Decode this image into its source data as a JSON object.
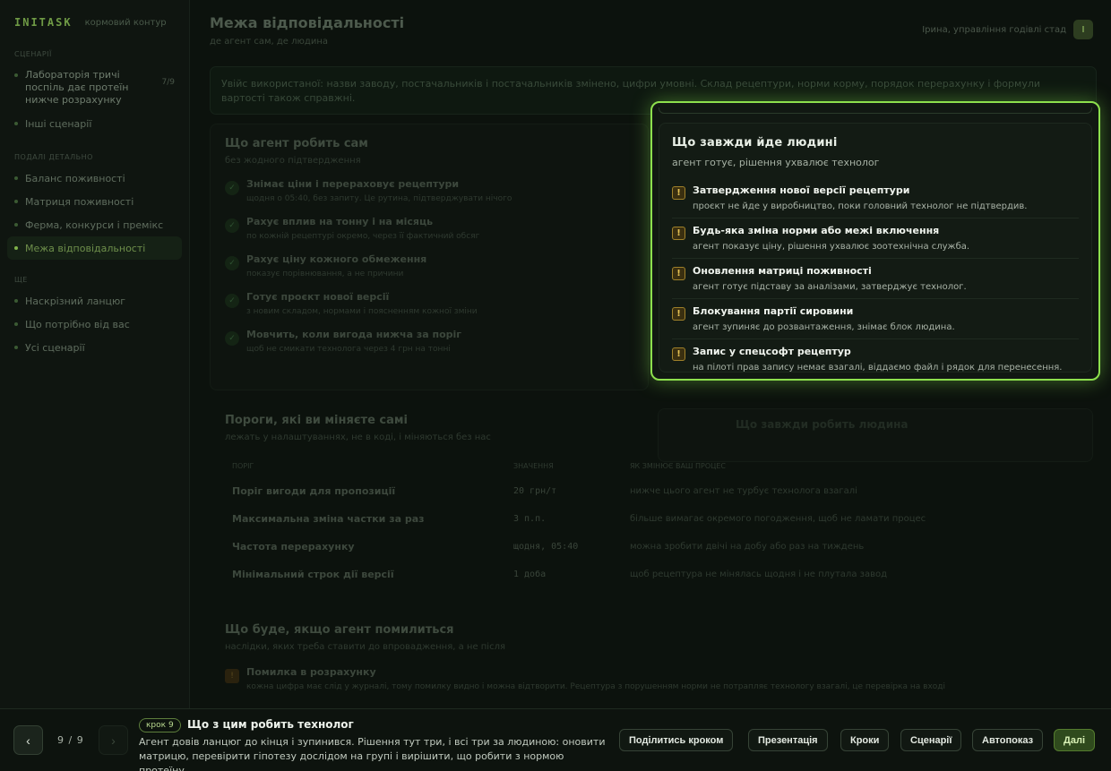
{
  "brand": {
    "logo": "INITASK",
    "subtitle": "кормовий контур"
  },
  "sidebar": {
    "scenarios_heading": "СЦЕНАРІЇ",
    "scenario": {
      "label": "Лабораторія тричі поспіль дає протеїн нижче розрахунку",
      "count": "7/9"
    },
    "other_scenarios": "Інші сценарії",
    "detail_heading": "ПОДАЛІ ДЕТАЛЬНО",
    "detail_items": [
      "Баланс поживності",
      "Матриця поживності",
      "Ферма, конкурси і премікс",
      "Межа відповідальності"
    ],
    "more_heading": "ЩЕ",
    "more_items": [
      "Наскрізний ланцюг",
      "Що потрібно від вас",
      "Усі сценарії"
    ]
  },
  "header": {
    "title": "Межа відповідальності",
    "subtitle": "де агент сам, де людина",
    "user": "Ірина, управління годівлі стад",
    "avatar": "І"
  },
  "callout": "Увійс використаної: назви заводу, постачальників і постачальників змінено, цифри умовні. Склад рецептури, норми корму, порядок перерахунку і формули вартості також справжні.",
  "agent_card": {
    "title": "Що агент робить сам",
    "subtitle": "без жодного підтвердження",
    "steps": [
      {
        "title": "Знімає ціни і перераховує рецептури",
        "desc": "щодня о 05:40, без запиту. Це рутина, підтверджувати нічого"
      },
      {
        "title": "Рахує вплив на тонну і на місяць",
        "desc": "по кожній рецептурі окремо, через її фактичний обсяг"
      },
      {
        "title": "Рахує ціну кожного обмеження",
        "desc": "показує порівнювання, а не причини"
      },
      {
        "title": "Готує проєкт нової версії",
        "desc": "з новим складом, нормами і поясненням кожної зміни"
      },
      {
        "title": "Мовчить, коли вигода нижча за поріг",
        "desc": "щоб не смикати технолога через 4 грн на тонні"
      }
    ]
  },
  "thresholds": {
    "title": "Пороги, які ви міняєте самі",
    "subtitle": "лежать у налаштуваннях, не в коді, і міняються без нас",
    "headers": [
      "ПОРІГ",
      "ЗНАЧЕННЯ",
      "ЯК ЗМІНЮЄ ВАШ ПРОЦЕС"
    ],
    "rows": [
      {
        "name": "Поріг вигоди для пропозиції",
        "value": "20 грн/т",
        "effect": "нижче цього агент не турбує технолога взагалі"
      },
      {
        "name": "Максимальна зміна частки за раз",
        "value": "3 п.п.",
        "effect": "більше вимагає окремого погодження, щоб не ламати процес"
      },
      {
        "name": "Частота перерахунку",
        "value": "щодня, 05:40",
        "effect": "можна зробити двічі на добу або раз на тиждень"
      },
      {
        "name": "Мінімальний строк дії версії",
        "value": "1 доба",
        "effect": "щоб рецептура не мінялась щодня і не плутала завод"
      }
    ]
  },
  "ghost_card_title": "Що завжди робить людина",
  "errors": {
    "title": "Що буде, якщо агент помилиться",
    "subtitle": "наслідки, яких треба ставити до впровадження, а не після",
    "item": {
      "title": "Помилка в розрахунку",
      "desc": "кожна цифра має слід у журналі, тому помилку видно і можна відтворити. Рецептура з порушенням норми не потрапляє технологу взагалі, це перевірка на вході"
    }
  },
  "modal": {
    "title": "Що завжди йде людині",
    "subtitle": "агент готує, рішення ухвалює технолог",
    "items": [
      {
        "title": "Затвердження нової версії рецептури",
        "desc": "проєкт не йде у виробництво, поки головний технолог не підтвердив."
      },
      {
        "title": "Будь-яка зміна норми або межі включення",
        "desc": "агент показує ціну, рішення ухвалює зоотехнічна служба."
      },
      {
        "title": "Оновлення матриці поживності",
        "desc": "агент готує підставу за аналізами, затверджує технолог."
      },
      {
        "title": "Блокування партії сировини",
        "desc": "агент зупиняє до розвантаження, знімає блок людина."
      },
      {
        "title": "Запис у спецсофт рецептур",
        "desc": "на пілоті прав запису немає взагалі, віддаємо файл і рядок для перенесення."
      }
    ]
  },
  "tour": {
    "prev_icon": "‹",
    "next_icon": "›",
    "counter": "9 / 9",
    "step_label": "крок 9",
    "step_title": "Що з цим робить технолог",
    "step_desc": "Агент довів ланцюг до кінця і зупинився. Рішення тут три, і всі три за людиною: оновити матрицю, перевірити гіпотезу дослідом на групі і вирішити, що робити з нормою протеїну.",
    "buttons": {
      "share": "Поділитись кроком",
      "present": "Презентація",
      "steps": "Кроки",
      "scenarios": "Сценарії",
      "autoplay": "Автопоказ",
      "next": "Далі"
    }
  },
  "colors": {
    "accent": "#8de04d",
    "warning": "#e6c355",
    "background": "#0b100c"
  }
}
